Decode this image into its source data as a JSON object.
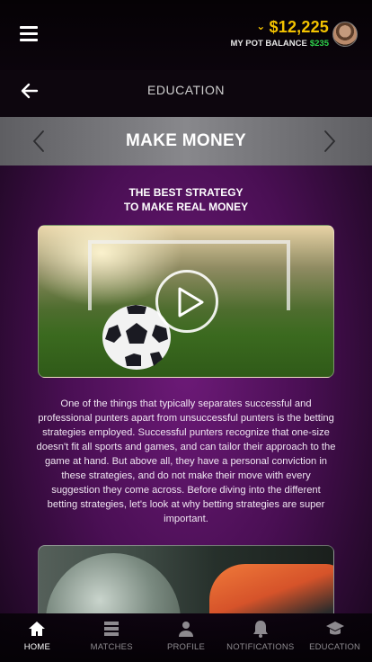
{
  "topbar": {
    "balance": "$12,225",
    "pot_label": "MY POT BALANCE",
    "pot_value": "$235"
  },
  "header": {
    "title": "EDUCATION"
  },
  "category": {
    "title": "MAKE MONEY"
  },
  "article": {
    "title_line1": "THE BEST STRATEGY",
    "title_line2": "TO MAKE REAL MONEY",
    "body": "One of the things that typically separates successful and professional punters apart from unsuccessful punters is the betting strategies employed. Successful punters recognize that one-size doesn't fit all sports and games, and can tailor their approach to the game at hand. But above all, they have a personal conviction in these strategies, and do not make their move with every suggestion they come across. Before diving into the different betting strategies, let's look at why betting strategies are super important."
  },
  "nav": {
    "items": [
      {
        "label": "HOME",
        "icon": "home-icon",
        "active": true
      },
      {
        "label": "MATCHES",
        "icon": "list-icon",
        "active": false
      },
      {
        "label": "PROFILE",
        "icon": "user-icon",
        "active": false
      },
      {
        "label": "NOTIFICATIONS",
        "icon": "bell-icon",
        "active": false
      },
      {
        "label": "EDUCATION",
        "icon": "graduation-cap-icon",
        "active": false
      }
    ]
  },
  "colors": {
    "balance": "#f2c200",
    "pot_value": "#2ed14b",
    "background": "#6d1a78"
  }
}
